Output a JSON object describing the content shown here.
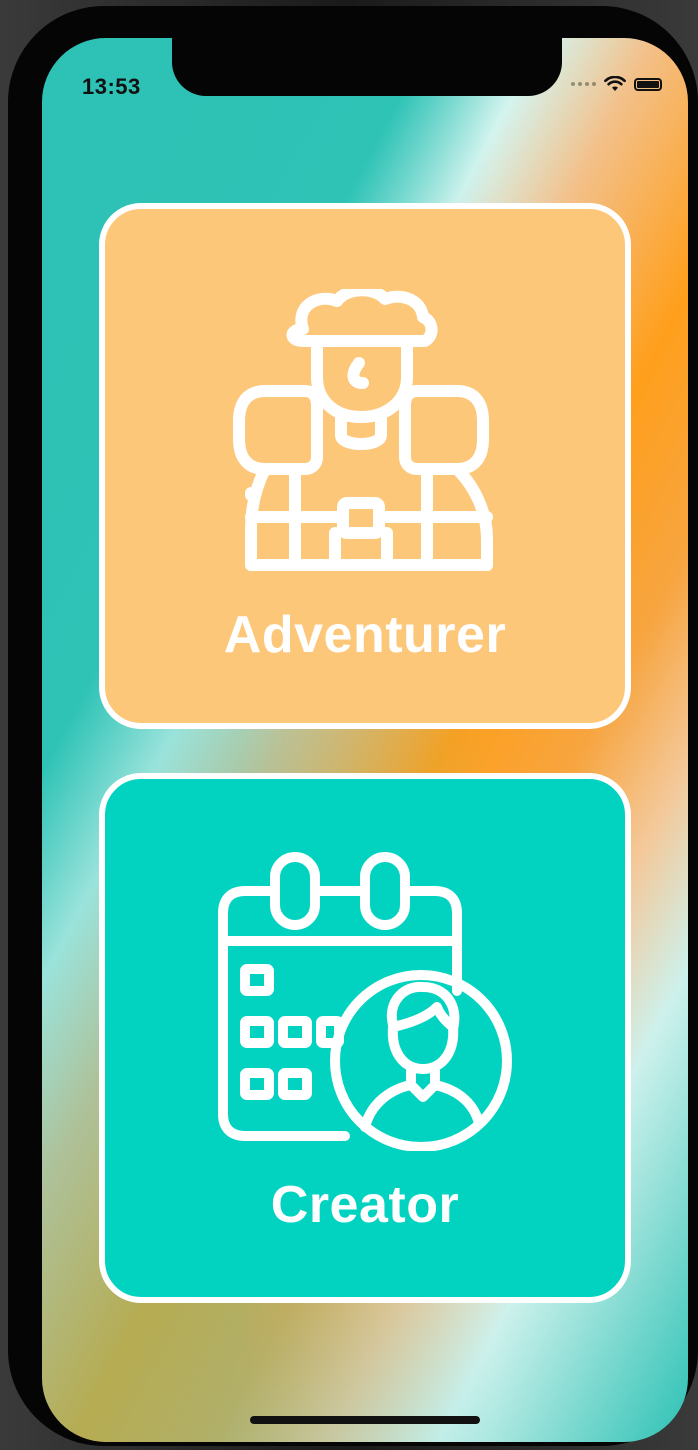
{
  "status_bar": {
    "time": "13:53",
    "wifi_icon": "wifi-icon",
    "battery_icon": "battery-icon"
  },
  "role_options": [
    {
      "label": "Adventurer",
      "icon": "backpacker-icon",
      "background_color": "#fdc77a"
    },
    {
      "label": "Creator",
      "icon": "calendar-user-icon",
      "background_color": "#02d3c1"
    }
  ],
  "colors": {
    "border": "#ffffff",
    "teal": "#2cc1b4",
    "orange": "#ff9f1c"
  }
}
